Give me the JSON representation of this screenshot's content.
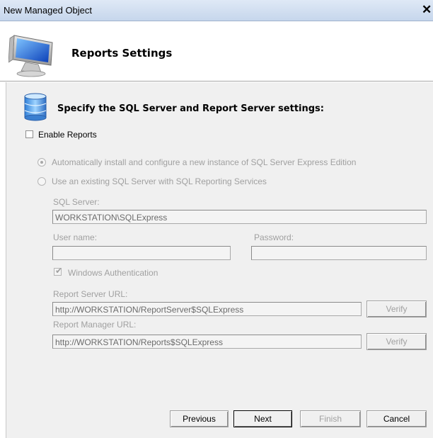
{
  "window": {
    "title": "New Managed Object"
  },
  "header": {
    "heading": "Reports Settings"
  },
  "section": {
    "heading": "Specify the SQL Server and Report Server settings:"
  },
  "enable_reports": {
    "label": "Enable Reports",
    "checked": false
  },
  "options": {
    "auto_install": {
      "label": "Automatically install and configure a new instance of SQL Server Express Edition",
      "selected": true
    },
    "use_existing": {
      "label": "Use an existing SQL Server with SQL Reporting Services",
      "selected": false
    }
  },
  "sql_server": {
    "label": "SQL Server:",
    "value": "WORKSTATION\\SQLExpress"
  },
  "user_name": {
    "label": "User name:",
    "value": ""
  },
  "password": {
    "label": "Password:",
    "value": ""
  },
  "windows_auth": {
    "label": "Windows Authentication",
    "checked": true
  },
  "report_server_url": {
    "label": "Report Server URL:",
    "value": "http://WORKSTATION/ReportServer$SQLExpress",
    "verify_label": "Verify"
  },
  "report_manager_url": {
    "label": "Report Manager URL:",
    "value": "http://WORKSTATION/Reports$SQLExpress",
    "verify_label": "Verify"
  },
  "buttons": {
    "previous": "Previous",
    "next": "Next",
    "finish": "Finish",
    "cancel": "Cancel"
  },
  "icons": {
    "close": "close-icon",
    "header": "computer-monitor-icon",
    "section": "database-icon"
  },
  "colors": {
    "titlebar": "#c6d6ec",
    "body": "#f0f0f0",
    "disabled_text": "#a0a0a0"
  }
}
